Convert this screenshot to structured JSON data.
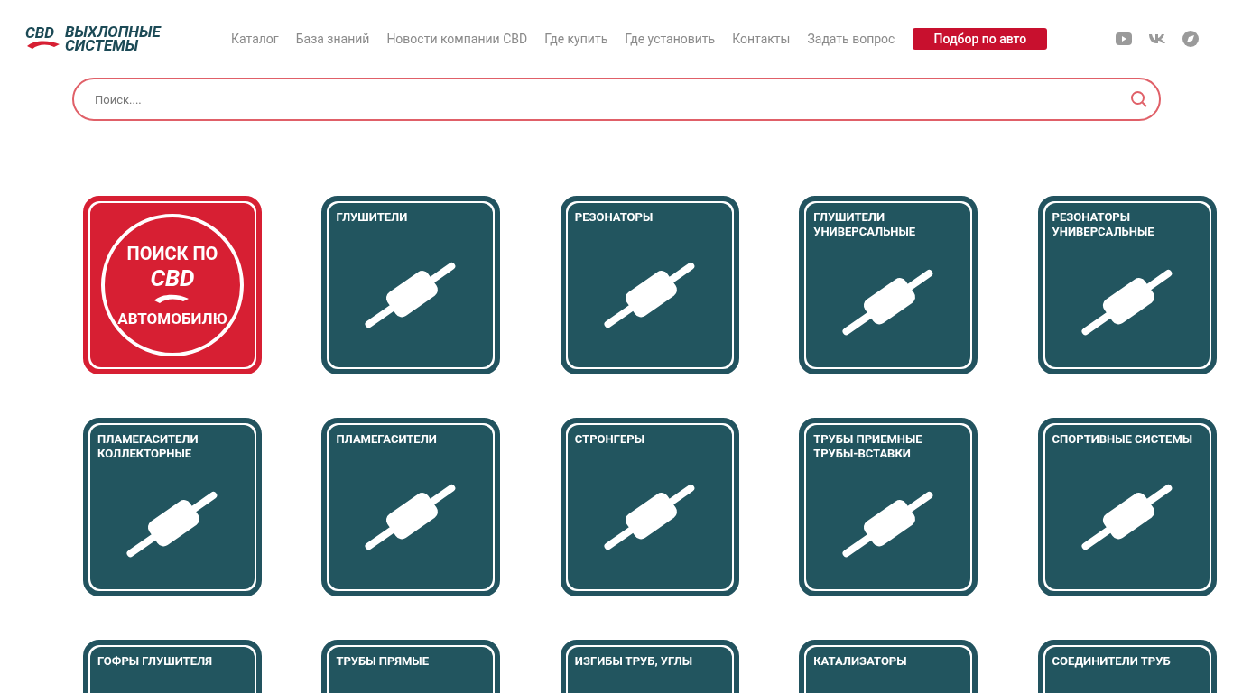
{
  "logo": {
    "brand": "CBD",
    "line1": "ВЫХЛОПНЫЕ",
    "line2": "СИСТЕМЫ"
  },
  "nav": [
    "Каталог",
    "База знаний",
    "Новости компании CBD",
    "Где купить",
    "Где установить",
    "Контакты",
    "Задать вопрос"
  ],
  "cta_button": "Подбор по авто",
  "search": {
    "placeholder": "Поиск...."
  },
  "tiles": [
    {
      "kind": "search",
      "top": "ПОИСК ПО",
      "brand": "CBD",
      "bottom": "АВТОМОБИЛЮ"
    },
    {
      "kind": "category",
      "title": "ГЛУШИТЕЛИ"
    },
    {
      "kind": "category",
      "title": "РЕЗОНАТОРЫ"
    },
    {
      "kind": "category",
      "title": "ГЛУШИТЕЛИ УНИВЕРСАЛЬНЫЕ"
    },
    {
      "kind": "category",
      "title": "РЕЗОНАТОРЫ УНИВЕРСАЛЬНЫЕ"
    },
    {
      "kind": "category",
      "title": "ПЛАМЕГАСИТЕЛИ КОЛЛЕКТОРНЫЕ"
    },
    {
      "kind": "category",
      "title": "ПЛАМЕГАСИТЕЛИ"
    },
    {
      "kind": "category",
      "title": "СТРОНГЕРЫ"
    },
    {
      "kind": "category",
      "title": "ТРУБЫ ПРИЕМНЫЕ ТРУБЫ-ВСТАВКИ"
    },
    {
      "kind": "category",
      "title": "СПОРТИВНЫЕ СИСТЕМЫ"
    },
    {
      "kind": "category",
      "title": "ГОФРЫ ГЛУШИТЕЛЯ"
    },
    {
      "kind": "category",
      "title": "ТРУБЫ ПРЯМЫЕ"
    },
    {
      "kind": "category",
      "title": "ИЗГИБЫ ТРУБ, УГЛЫ"
    },
    {
      "kind": "category",
      "title": "КАТАЛИЗАТОРЫ"
    },
    {
      "kind": "category",
      "title": "СОЕДИНИТЕЛИ ТРУБ"
    }
  ]
}
